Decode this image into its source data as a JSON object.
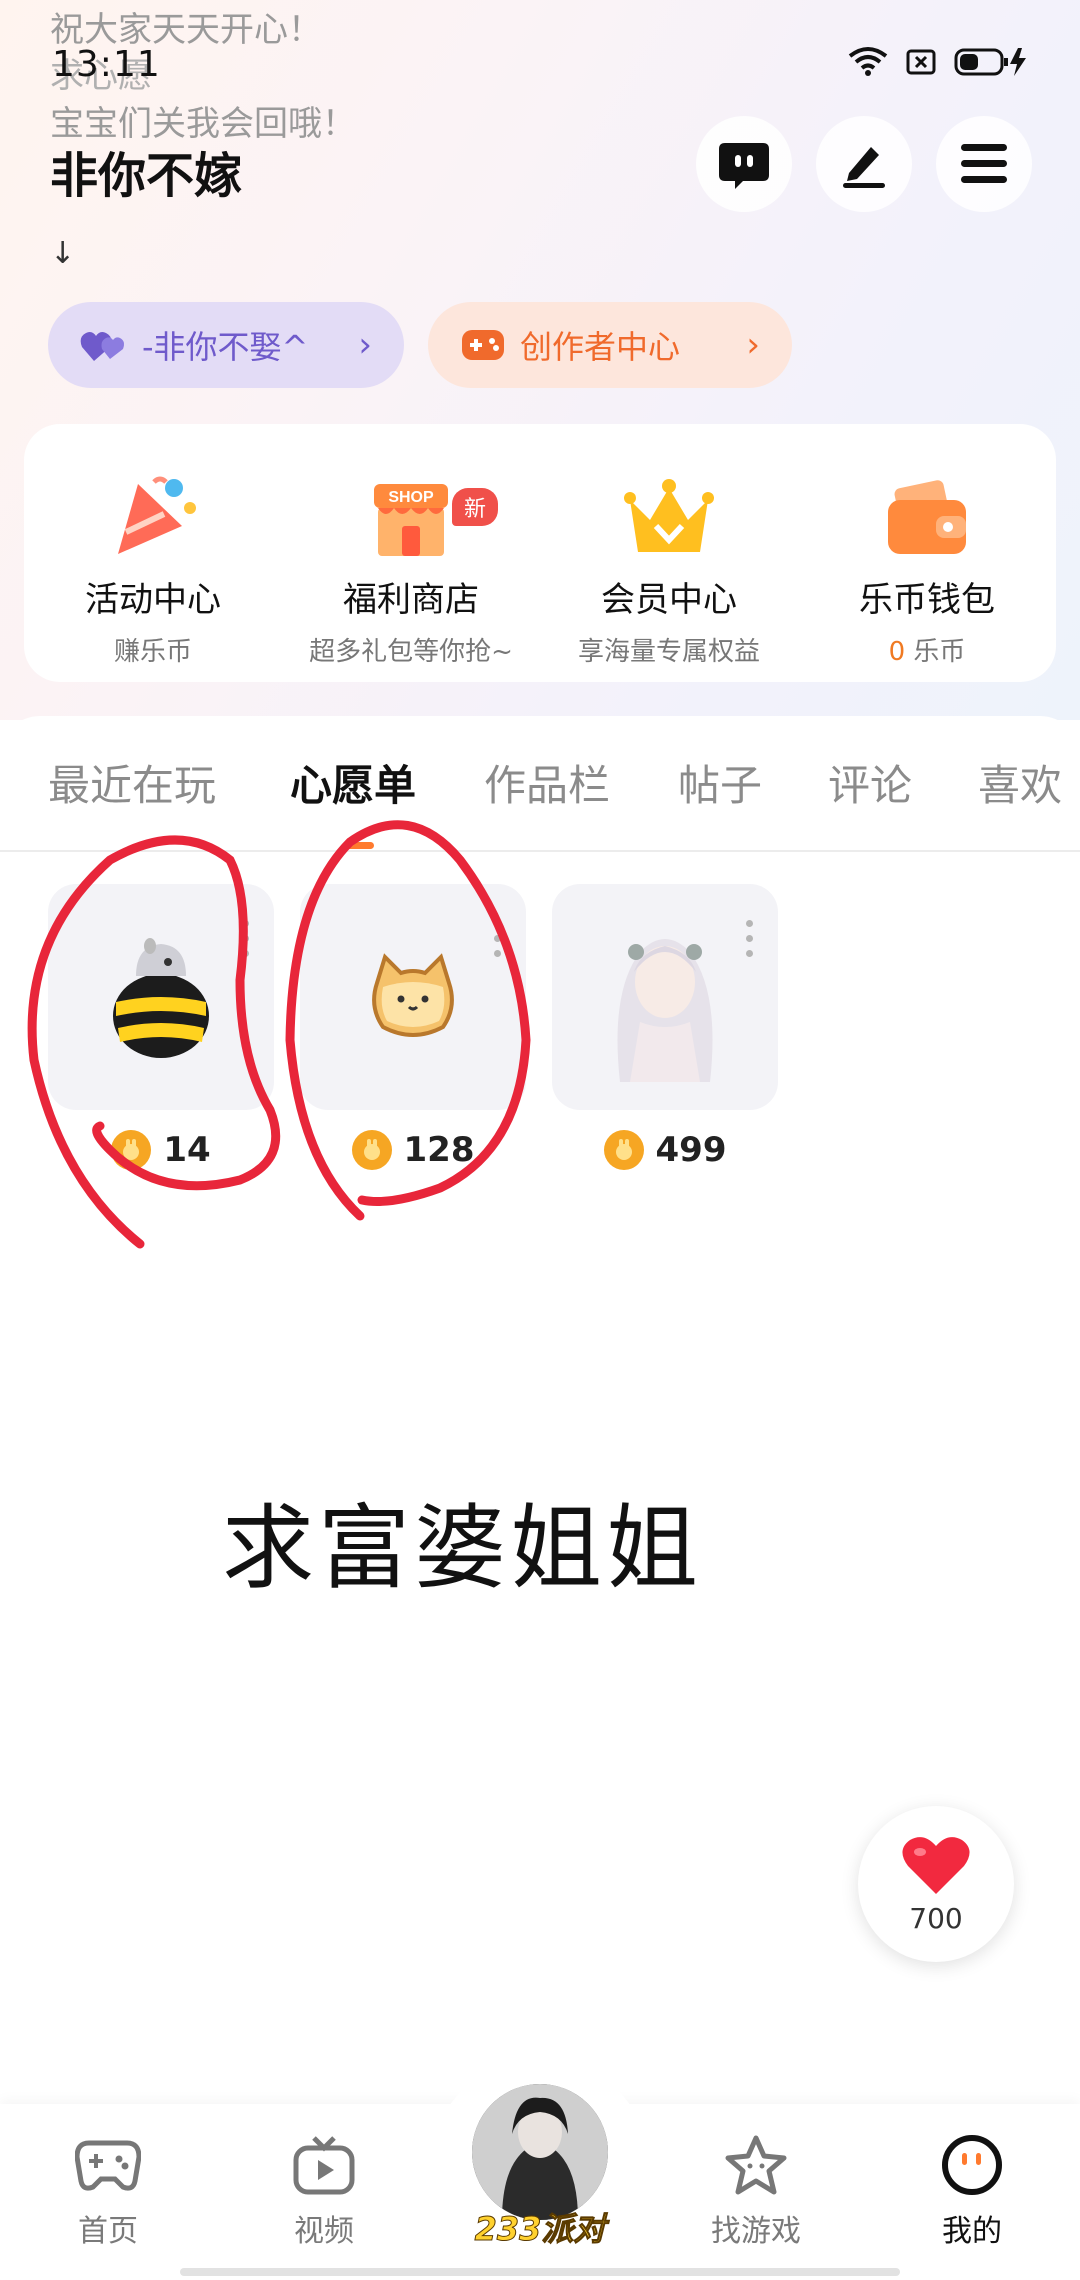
{
  "status_bar": {
    "time": "13:11"
  },
  "profile": {
    "bio_lines": [
      "祝大家天天开心！",
      "求心愿",
      "宝宝们关我会回哦！"
    ],
    "nickname": "非你不嫁",
    "arrow": "↓"
  },
  "pills": {
    "hearts_label": "-非你不娶^",
    "creator_label": "创作者中心",
    "chevron": "›"
  },
  "quick_links": [
    {
      "title": "活动中心",
      "sub": "赚乐币",
      "icon": "party-popper-icon"
    },
    {
      "title": "福利商店",
      "sub": "超多礼包等你抢~",
      "icon": "shop-icon",
      "badge": "新"
    },
    {
      "title": "会员中心",
      "sub": "享海量专属权益",
      "icon": "crown-icon"
    },
    {
      "title": "乐币钱包",
      "sub_value": "0",
      "sub_unit": "乐币",
      "icon": "wallet-icon"
    }
  ],
  "tabs": [
    "最近在玩",
    "心愿单",
    "作品栏",
    "帖子",
    "评论",
    "喜欢"
  ],
  "active_tab": "心愿单",
  "wishlist": [
    {
      "price": "14",
      "item": "bee-bottle-item"
    },
    {
      "price": "128",
      "item": "cat-bread-item"
    },
    {
      "price": "499",
      "item": "anime-girl-avatar-item"
    }
  ],
  "overlay_text": "求富婆姐姐",
  "like": {
    "count": "700"
  },
  "bottom_nav": {
    "items": [
      "首页",
      "视频",
      "找游戏",
      "我的"
    ],
    "center_label": "233派对",
    "active": "我的"
  },
  "colors": {
    "accent_orange": "#ff7a2e",
    "annotation_red": "#e8263a",
    "hearts_purple": "#6f5acb"
  }
}
